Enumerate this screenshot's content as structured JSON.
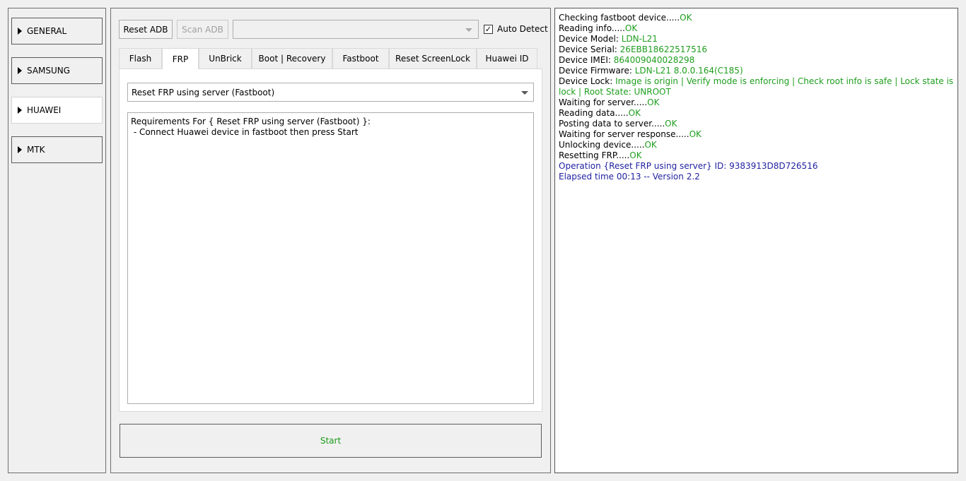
{
  "sidebar": {
    "items": [
      {
        "label": "GENERAL",
        "active": false
      },
      {
        "label": "SAMSUNG",
        "active": false
      },
      {
        "label": "HUAWEI",
        "active": true
      },
      {
        "label": "MTK",
        "active": false
      }
    ]
  },
  "toolbar": {
    "reset_adb_label": "Reset ADB",
    "scan_adb_label": "Scan ADB",
    "device_combo_value": "",
    "auto_detect_label": "Auto Detect",
    "auto_detect_checked": "✓"
  },
  "tabs": [
    {
      "label": "Flash"
    },
    {
      "label": "FRP"
    },
    {
      "label": "UnBrick"
    },
    {
      "label": "Boot | Recovery"
    },
    {
      "label": "Fastboot"
    },
    {
      "label": "Reset ScreenLock"
    },
    {
      "label": "Huawei ID"
    }
  ],
  "frp": {
    "operation_selected": "Reset FRP using server (Fastboot)",
    "requirements_line1": "Requirements For { Reset FRP using server (Fastboot) }:",
    "requirements_line2": " - Connect Huawei device in fastboot then press Start"
  },
  "start_label": "Start",
  "log": {
    "l1_label": "Checking fastboot device.....",
    "l1_status": "OK",
    "l2_label": "Reading info.....",
    "l2_status": "OK",
    "l3_label": "Device Model: ",
    "l3_value": "LDN-L21",
    "l4_label": "Device Serial: ",
    "l4_value": "26EBB18622517516",
    "l5_label": "Device IMEI: ",
    "l5_value": "864009040028298",
    "l6_label": "Device Firmware: ",
    "l6_value": "LDN-L21 8.0.0.164(C185)",
    "l7_label": "Device Lock: ",
    "l7_value": "Image is origin | Verify mode is enforcing | Check root info is safe | Lock state is lock | Root State: UNROOT",
    "l8_label": "Waiting for server.....",
    "l8_status": "OK",
    "l9_label": "Reading data.....",
    "l9_status": "OK",
    "l10_label": "Posting data to server.....",
    "l10_status": "OK",
    "l11_label": "Waiting for server response.....",
    "l11_status": "OK",
    "l12_label": "Unlocking device.....",
    "l12_status": "OK",
    "l13_label": "Resetting FRP.....",
    "l13_status": "OK",
    "l14": "Operation {Reset FRP using server} ID: 9383913D8D726516",
    "l15": "Elapsed time 00:13 -- Version 2.2"
  },
  "colors": {
    "ok_green": "#1e9e1e",
    "info_blue": "#1f1fa0",
    "start_green": "#1a9a1a"
  }
}
